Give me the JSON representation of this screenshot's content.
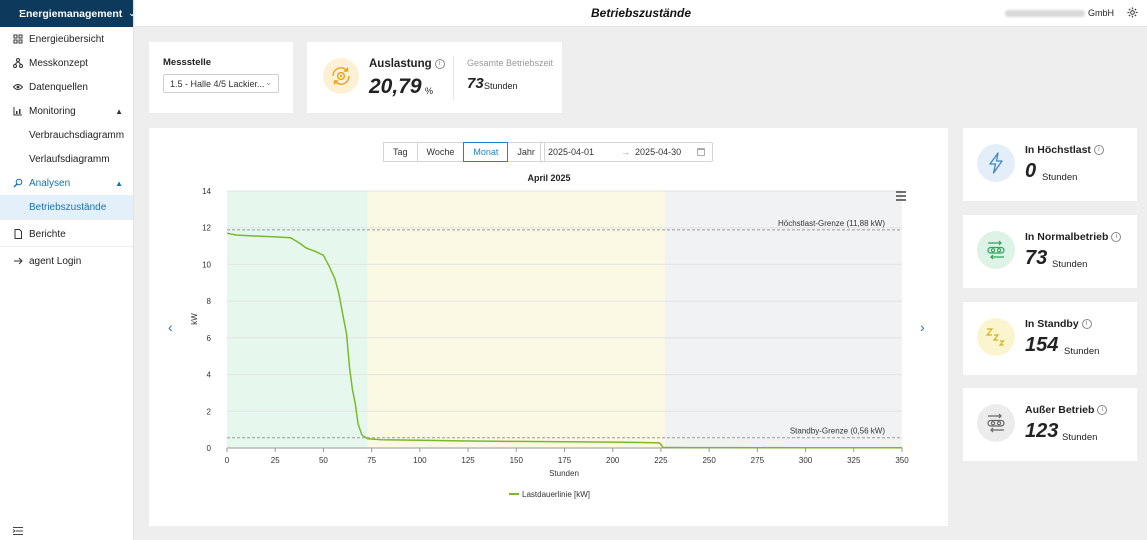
{
  "sidebar": {
    "app_switch": "Energiemanagement",
    "items": [
      {
        "label": "Energieübersicht"
      },
      {
        "label": "Messkonzept"
      },
      {
        "label": "Datenquellen"
      },
      {
        "label": "Monitoring"
      },
      {
        "label": "Verbrauchsdiagramm"
      },
      {
        "label": "Verlaufsdiagramm"
      },
      {
        "label": "Analysen"
      },
      {
        "label": "Betriebszustände"
      },
      {
        "label": "Berichte"
      },
      {
        "label": "agent Login"
      }
    ]
  },
  "header": {
    "title": "Betriebszustände",
    "company_suffix": "GmbH"
  },
  "messstelle": {
    "label": "Messstelle",
    "selected": "1.5 - Halle 4/5 Lackier..."
  },
  "auslastung": {
    "title": "Auslastung",
    "value": "20,79",
    "unit": "%",
    "betriebszeit_label": "Gesamte Betriebszeit",
    "betriebszeit_value": "73",
    "betriebszeit_unit": "Stunden"
  },
  "period": {
    "options": [
      "Tag",
      "Woche",
      "Monat",
      "Jahr"
    ],
    "active": "Monat",
    "start_date": "2025-04-01",
    "end_date": "2025-04-30"
  },
  "kpis": [
    {
      "title": "In Höchstlast",
      "value": "0",
      "unit": "Stunden",
      "color": "#e3eef8",
      "icon": "lightning-icon"
    },
    {
      "title": "In Normalbetrieb",
      "value": "73",
      "unit": "Stunden",
      "color": "#ddf3e6",
      "icon": "toggle-flow-icon"
    },
    {
      "title": "In Standby",
      "value": "154",
      "unit": "Stunden",
      "color": "#fbf5cf",
      "icon": "sleep-zzz-icon"
    },
    {
      "title": "Außer Betrieb",
      "value": "123",
      "unit": "Stunden",
      "color": "#ececec",
      "icon": "off-switch-icon"
    }
  ],
  "chart_data": {
    "type": "line",
    "title": "April 2025",
    "xlabel": "Stunden",
    "ylabel": "kW",
    "xlim": [
      0,
      350
    ],
    "ylim": [
      0,
      14
    ],
    "x_ticks": [
      0,
      25,
      50,
      75,
      100,
      125,
      150,
      175,
      200,
      225,
      250,
      275,
      300,
      325,
      350
    ],
    "y_ticks": [
      0,
      2,
      4,
      6,
      8,
      10,
      12,
      14
    ],
    "grid": true,
    "legend": "bottom-center",
    "bands": [
      {
        "from": 0,
        "to": 73,
        "color": "#e6f8ee"
      },
      {
        "from": 73,
        "to": 227,
        "color": "#fbf9e3"
      },
      {
        "from": 227,
        "to": 350,
        "color": "#f1f2f4"
      }
    ],
    "thresholds": [
      {
        "value": 11.88,
        "label": "Höchstlast-Grenze (11,88 kW)"
      },
      {
        "value": 0.56,
        "label": "Standby-Grenze (0,56 kW)"
      }
    ],
    "series": [
      {
        "name": "Lastdauerlinie [kW]",
        "color": "#7ab929",
        "x": [
          0,
          5,
          15,
          25,
          33,
          37,
          41,
          46,
          50,
          53,
          56,
          58,
          60,
          62,
          63.5,
          65,
          66.5,
          68,
          70,
          73,
          80,
          100,
          125,
          150,
          175,
          200,
          215,
          224,
          225,
          226,
          240,
          260,
          300,
          350
        ],
        "y": [
          11.7,
          11.6,
          11.55,
          11.5,
          11.45,
          11.2,
          10.9,
          10.7,
          10.5,
          9.9,
          9.2,
          8.4,
          7.3,
          6.2,
          4.4,
          3.2,
          2.4,
          1.3,
          0.7,
          0.5,
          0.45,
          0.42,
          0.38,
          0.36,
          0.34,
          0.32,
          0.3,
          0.28,
          0.2,
          0.03,
          0.02,
          0.02,
          0.01,
          0.01
        ]
      }
    ]
  }
}
